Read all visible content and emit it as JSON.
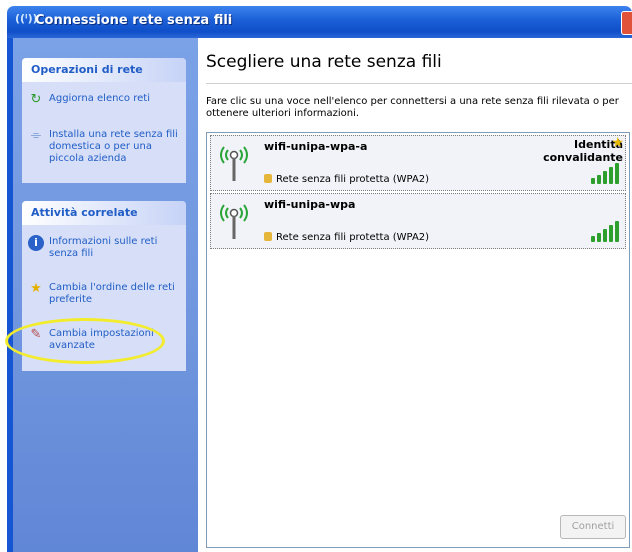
{
  "window": {
    "title": "Connessione rete senza fili",
    "title_icon": "((ᴵ))"
  },
  "sidebar": {
    "network_ops": {
      "title": "Operazioni di rete",
      "items": [
        {
          "label": "Aggiorna elenco reti",
          "icon": "refresh-icon"
        },
        {
          "label": "Installa una rete senza fili domestica o per una piccola azienda",
          "icon": "setup-wizard-icon"
        }
      ]
    },
    "related_tasks": {
      "title": "Attività correlate",
      "items": [
        {
          "label": "Informazioni sulle reti senza fili",
          "icon": "info-icon"
        },
        {
          "label": "Cambia l'ordine delle reti preferite",
          "icon": "star-icon"
        },
        {
          "label": "Cambia impostazioni avanzate",
          "icon": "settings-icon"
        }
      ]
    }
  },
  "main": {
    "heading": "Scegliere una rete senza fili",
    "description": "Fare clic su una voce nell'elenco per connettersi a una rete senza fili rilevata o per ottenere ulteriori informazioni.",
    "networks": [
      {
        "ssid": "wifi-unipa-wpa-a",
        "security": "Rete senza fili protetta (WPA2)",
        "status": "Identità convalidante",
        "signal_bars": 5
      },
      {
        "ssid": "wifi-unipa-wpa",
        "security": "Rete senza fili protetta (WPA2)",
        "status": "",
        "signal_bars": 5
      }
    ],
    "connect_label": "Connetti"
  },
  "colors": {
    "titlebar": "#0f4fc9",
    "sidebar": "#6f95de",
    "link": "#215dc6",
    "highlight": "#f2ec2c"
  }
}
